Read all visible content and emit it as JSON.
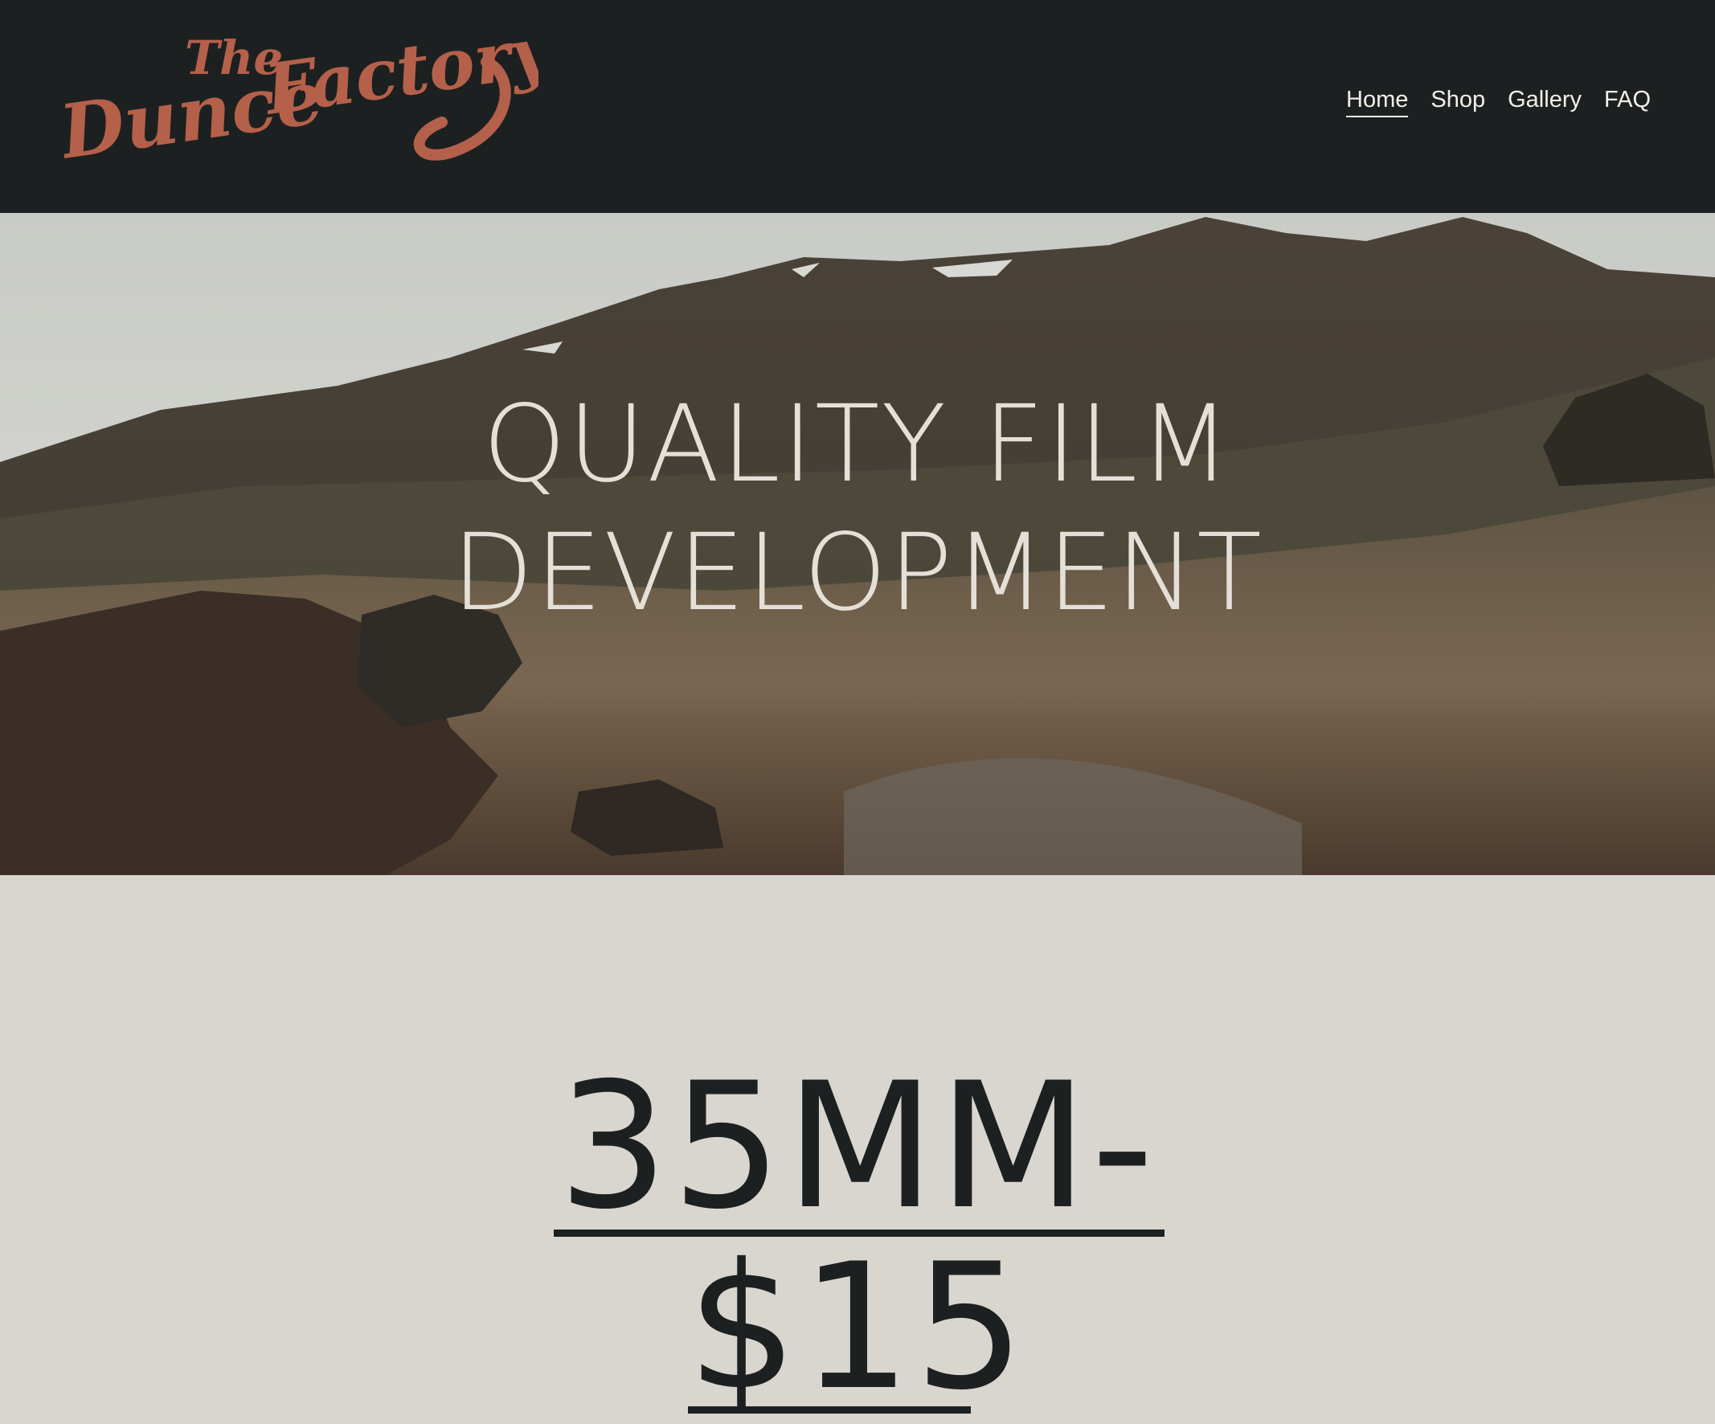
{
  "header": {
    "logo": {
      "line1": "The",
      "line2": "Dunce",
      "line3": "Factory",
      "color": "#b5604a"
    },
    "nav": [
      {
        "label": "Home",
        "active": true
      },
      {
        "label": "Shop",
        "active": false
      },
      {
        "label": "Gallery",
        "active": false
      },
      {
        "label": "FAQ",
        "active": false
      }
    ]
  },
  "hero": {
    "title_line1": "QUALITY FILM",
    "title_line2": "DEVELOPMENT"
  },
  "pricing": {
    "line1": "35MM-",
    "line2": "$15"
  },
  "colors": {
    "header_bg": "#1c2020",
    "page_bg": "#d9d5cf",
    "accent": "#b5604a",
    "hero_text": "#e4e0d8"
  }
}
